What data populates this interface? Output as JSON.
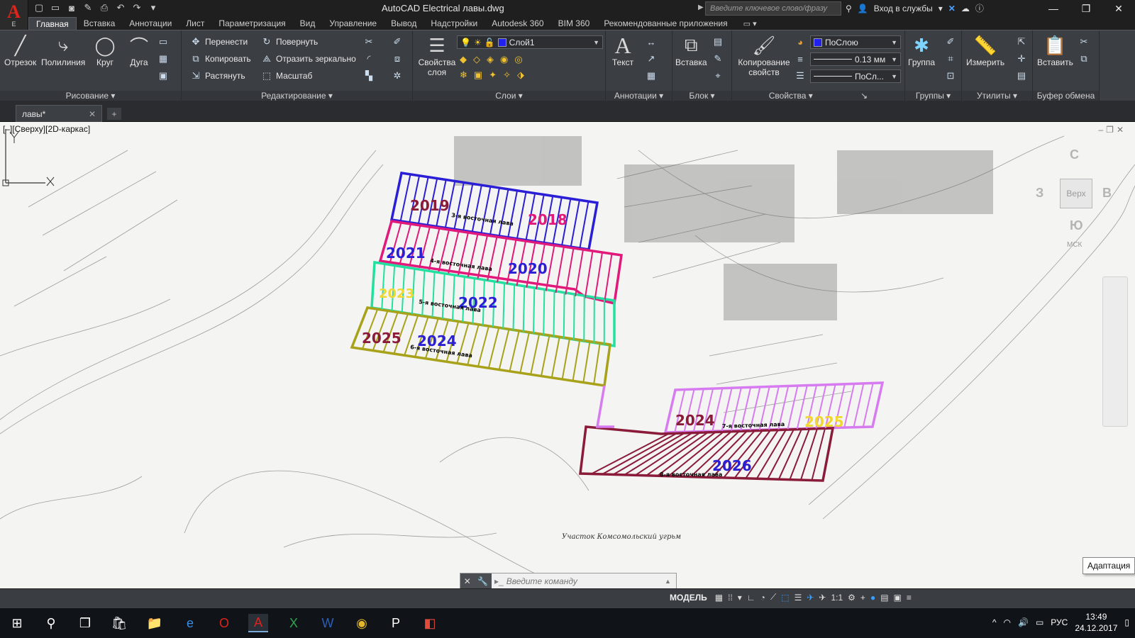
{
  "app": {
    "logo_letter": "A",
    "logo_sub": "E",
    "title": "AutoCAD Electrical   лавы.dwg",
    "search_placeholder": "Введите ключевое слово/фразу",
    "signin": "Вход в службы"
  },
  "ribbon_tabs": [
    "Главная",
    "Вставка",
    "Аннотации",
    "Лист",
    "Параметризация",
    "Вид",
    "Управление",
    "Вывод",
    "Надстройки",
    "Autodesk 360",
    "BIM 360",
    "Рекомендованные приложения"
  ],
  "ribbon": {
    "draw": {
      "title": "Рисование",
      "line": "Отрезок",
      "polyline": "Полилиния",
      "circle": "Круг",
      "arc": "Дуга"
    },
    "modify": {
      "title": "Редактирование",
      "move": "Перенести",
      "copy": "Копировать",
      "stretch": "Растянуть",
      "rotate": "Повернуть",
      "mirror": "Отразить зеркально",
      "scale": "Масштаб"
    },
    "layers": {
      "title": "Слои",
      "properties": "Свойства слоя",
      "current_layer": "Слой1"
    },
    "annotation": {
      "title": "Аннотации",
      "text": "Текст"
    },
    "block": {
      "title": "Блок",
      "insert": "Вставка"
    },
    "properties": {
      "title": "Свойства",
      "match": "Копирование свойств",
      "color": "ПоСлою",
      "lineweight": "0.13 мм",
      "linetype": "ПоСл..."
    },
    "groups": {
      "title": "Группы",
      "group": "Группа"
    },
    "utilities": {
      "title": "Утилиты",
      "measure": "Измерить"
    },
    "clipboard": {
      "title": "Буфер обмена",
      "paste": "Вставить"
    }
  },
  "file_tab": {
    "name": "лавы*"
  },
  "viewport": {
    "label": "[–][Сверху][2D-каркас]"
  },
  "viewcube": {
    "top": "Верх",
    "north": "С",
    "east": "В",
    "south": "Ю",
    "west": "З",
    "wcs": "МСК"
  },
  "drawing": {
    "year_labels": [
      "2019",
      "2018",
      "2021",
      "2020",
      "2023",
      "2022",
      "2025",
      "2024",
      "2024",
      "2025",
      "2026"
    ],
    "lava_labels": [
      "3-я восточная лава",
      "4-я восточная лава",
      "5-я восточная лава",
      "6-я восточная лава",
      "7-я восточная лава",
      "8-я восточная лава"
    ],
    "map_caption": "Участок Комсомольский угрьм",
    "colors": {
      "blue": "#2b1fd6",
      "magenta": "#e0197a",
      "teal": "#22e0a0",
      "olive": "#a8a21a",
      "violet": "#d77cf0",
      "maroon": "#8a1c3a",
      "yellow": "#f0d830"
    }
  },
  "tooltip": "Адаптация",
  "command": {
    "placeholder": "Введите команду"
  },
  "status": {
    "model": "МОДЕЛЬ",
    "scale": "1:1"
  },
  "taskbar": {
    "lang": "РУС",
    "time": "13:49",
    "date": "24.12.2017"
  }
}
